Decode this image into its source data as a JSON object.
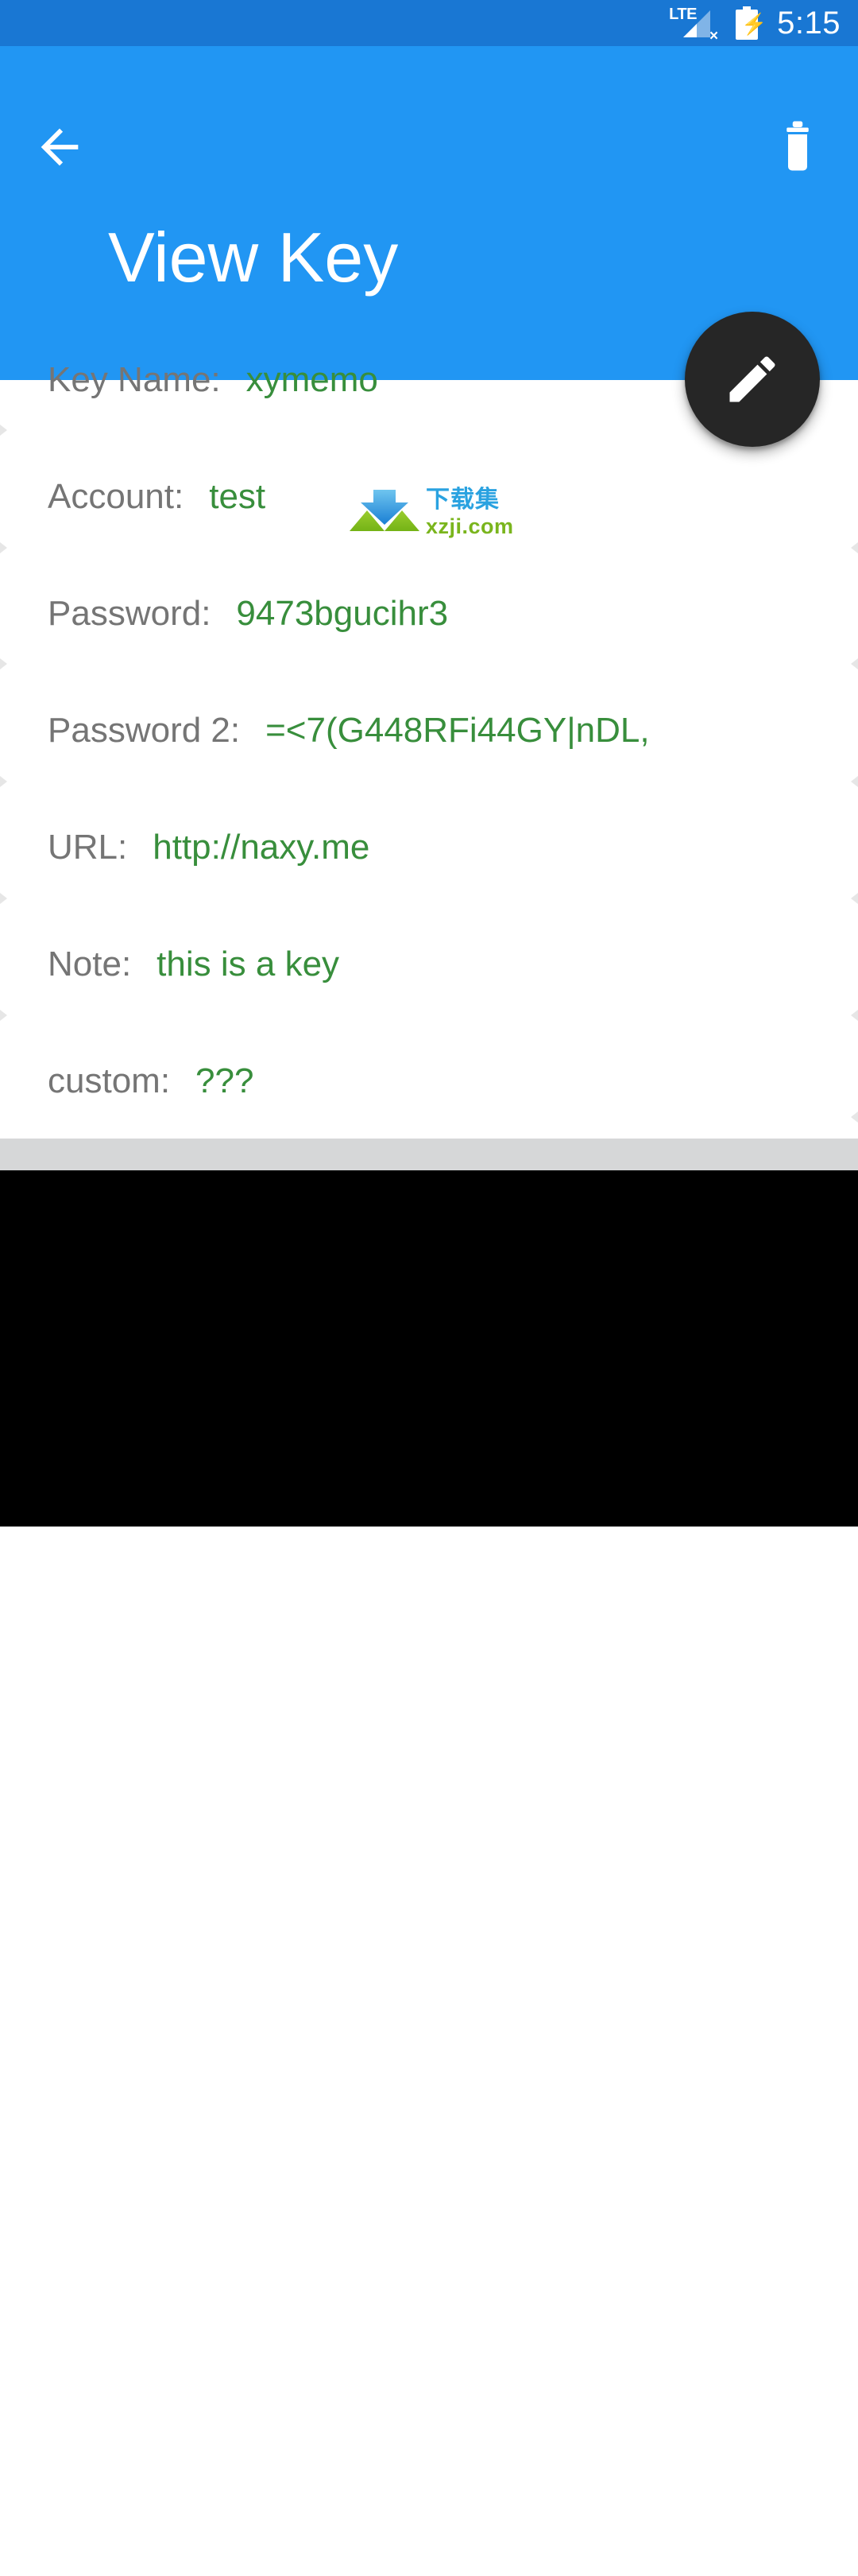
{
  "status_bar": {
    "network_label": "LTE",
    "signal_icon": "signal-bars-no-connection-icon",
    "battery_icon": "battery-charging-icon",
    "time": "5:15",
    "background_color": "#1977D3"
  },
  "appbar": {
    "back_icon": "arrow-back-icon",
    "delete_icon": "trash-can-icon",
    "title": "View Key",
    "background_color": "#2196F3"
  },
  "fab": {
    "icon": "pencil-edit-icon",
    "label": "Edit",
    "background_color": "#262626",
    "icon_color": "#FFFFFF"
  },
  "details": {
    "label_color": "#757575",
    "value_color": "#388E3C",
    "fields": [
      {
        "label": "Key Name:",
        "value": "xymemo"
      },
      {
        "label": "Account:",
        "value": "test"
      },
      {
        "label": "Password:",
        "value": "9473bgucihr3"
      },
      {
        "label": "Password 2:",
        "value": "=<7(G448RFi44GY|nDL,"
      },
      {
        "label": "URL:",
        "value": "http://naxy.me"
      },
      {
        "label": "Note:",
        "value": "this is a key"
      },
      {
        "label": "custom:",
        "value": "???"
      }
    ]
  },
  "watermark": {
    "icon": "download-arrow-logo-icon",
    "text_cn": "下载集",
    "text_en": "xzji.com",
    "color_cn": "#2AA2E0",
    "color_en": "#7AB51D"
  },
  "navbar": {
    "background_color": "#000000",
    "buttons": [
      {
        "name": "back",
        "icon": "nav-back-triangle-icon"
      },
      {
        "name": "home",
        "icon": "nav-home-circle-icon"
      },
      {
        "name": "recents",
        "icon": "nav-recents-square-icon"
      }
    ]
  }
}
